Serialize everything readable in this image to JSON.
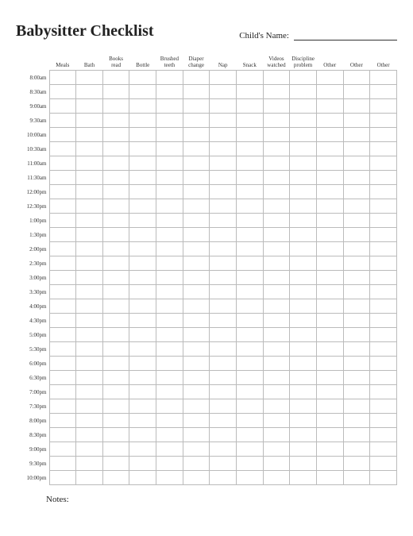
{
  "header": {
    "title": "Babysitter Checklist",
    "child_name_label": "Child's Name:"
  },
  "columns": [
    "Meals",
    "Bath",
    "Books read",
    "Bottle",
    "Brushed teeth",
    "Diaper change",
    "Nap",
    "Snack",
    "Videos watched",
    "Discipline problem",
    "Other",
    "Other",
    "Other"
  ],
  "times": [
    "8:00am",
    "8:30am",
    "9:00am",
    "9:30am",
    "10:00am",
    "10:30am",
    "11:00am",
    "11:30am",
    "12:00pm",
    "12:30pm",
    "1:00pm",
    "1:30pm",
    "2:00pm",
    "2:30pm",
    "3:00pm",
    "3:30pm",
    "4:00pm",
    "4:30pm",
    "5:00pm",
    "5:30pm",
    "6:00pm",
    "6:30pm",
    "7:00pm",
    "7:30pm",
    "8:00pm",
    "8:30pm",
    "9:00pm",
    "9:30pm",
    "10:00pm"
  ],
  "notes_label": "Notes:"
}
